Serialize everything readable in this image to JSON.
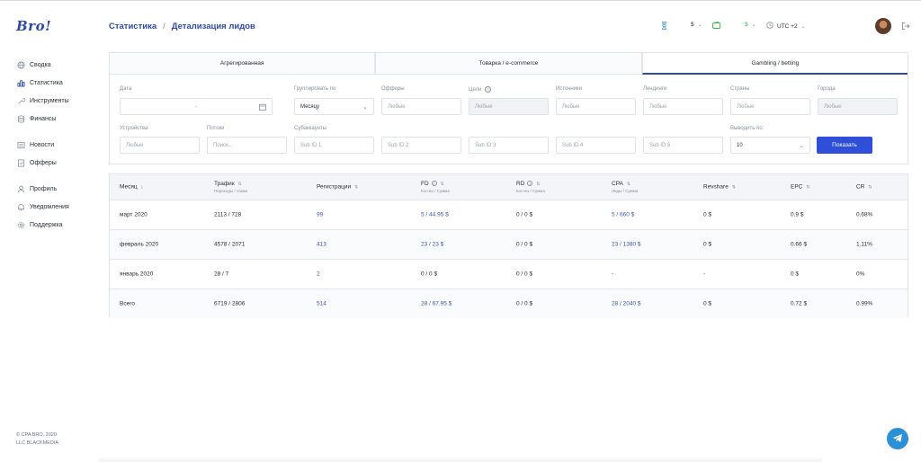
{
  "logo": "Bro!",
  "sidebar": {
    "items": [
      {
        "label": "Сводка",
        "icon": "globe-icon"
      },
      {
        "label": "Статистика",
        "icon": "bar-chart-icon",
        "active": true
      },
      {
        "label": "Инструменты",
        "icon": "wrench-icon"
      },
      {
        "label": "Финансы",
        "icon": "database-icon"
      },
      {
        "label": "Новости",
        "icon": "newspaper-icon"
      },
      {
        "label": "Офферы",
        "icon": "document-icon"
      },
      {
        "label": "Профиль",
        "icon": "user-icon"
      },
      {
        "label": "Уведомления",
        "icon": "bell-icon"
      },
      {
        "label": "Поддержка",
        "icon": "gear-icon"
      }
    ]
  },
  "footer": {
    "line1": "© CPA BRO, 2020",
    "line2": "LLC BLACKMEDIA"
  },
  "breadcrumb": {
    "parent": "Статистика",
    "separator": "/",
    "current": "Детализация лидов"
  },
  "header": {
    "currency1": "$",
    "currency2": "$",
    "timezone": "UTC +2"
  },
  "tabs": [
    {
      "label": "Агрегированная"
    },
    {
      "label": "Товарка / e-commerce"
    },
    {
      "label": "Gambling / betting",
      "active": true
    }
  ],
  "filters": {
    "date": {
      "label": "Дата",
      "separator": "-"
    },
    "group_by": {
      "label": "Группировать по",
      "value": "Месяцу"
    },
    "offers": {
      "label": "Офферы",
      "placeholder": "Любые"
    },
    "goals": {
      "label": "Цели",
      "placeholder": "Любые"
    },
    "sources": {
      "label": "Источники",
      "placeholder": "Любые"
    },
    "landings": {
      "label": "Лендинги",
      "placeholder": "Любые"
    },
    "countries": {
      "label": "Страны",
      "placeholder": "Любые"
    },
    "cities": {
      "label": "Города",
      "placeholder": "Любые"
    },
    "devices": {
      "label": "Устройства",
      "placeholder": "Любые"
    },
    "streams": {
      "label": "Потоки",
      "placeholder": "Поиск..."
    },
    "subaccounts": {
      "label": "Субаккаунты",
      "sub1": "Sub ID 1",
      "sub2": "Sub ID 2",
      "sub3": "Sub ID 3",
      "sub4": "Sub ID 4",
      "sub5": "Sub ID 5"
    },
    "per_page": {
      "label": "Выводить по:",
      "value": "10"
    },
    "show_button": "Показать"
  },
  "table": {
    "headers": {
      "month": "Месяц",
      "traffic": "Трафик",
      "traffic_sub": "Переходы / Уники",
      "registrations": "Регистрации",
      "fd": "FD",
      "fd_sub": "Кол-во / Сумма",
      "rd": "RD",
      "rd_sub": "Кол-во / Сумма",
      "cpa": "CPA",
      "cpa_sub": "Лиды / Сумма",
      "revshare": "Revshare",
      "epc": "EPC",
      "cr": "CR"
    },
    "rows": [
      {
        "month": "март 2020",
        "traffic": "2113 / 728",
        "registrations": "99",
        "fd": "5 / 44.95 $",
        "rd": "0 / 0 $",
        "cpa": "5 / 660 $",
        "revshare": "0 $",
        "epc": "0.9 $",
        "cr": "0.68%"
      },
      {
        "month": "февраль 2020",
        "traffic": "4578 / 2071",
        "registrations": "413",
        "fd": "23 / 23 $",
        "rd": "0 / 0 $",
        "cpa": "23 / 1380 $",
        "revshare": "0 $",
        "epc": "0.66 $",
        "cr": "1.11%"
      },
      {
        "month": "январь 2020",
        "traffic": "28 / 7",
        "registrations": "2",
        "fd": "0 / 0 $",
        "rd": "0 / 0 $",
        "cpa": "-",
        "revshare": "-",
        "epc": "0 $",
        "cr": "0%"
      },
      {
        "month": "Всего",
        "traffic": "6719 / 2806",
        "registrations": "514",
        "fd": "28 / 67.95 $",
        "rd": "0 / 0 $",
        "cpa": "28 / 2040 $",
        "revshare": "0 $",
        "epc": "0.72 $",
        "cr": "0.99%"
      }
    ]
  }
}
